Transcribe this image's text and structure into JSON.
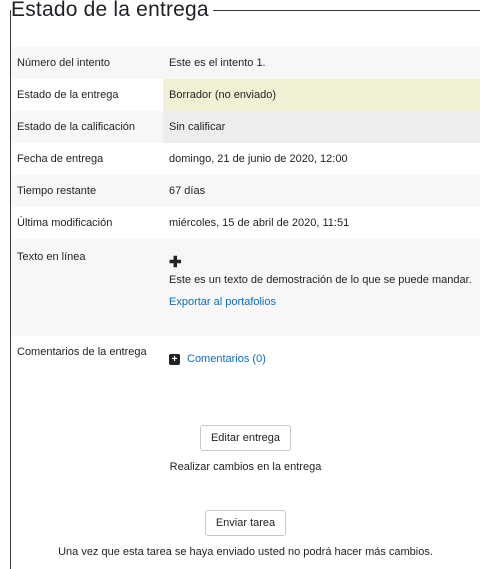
{
  "heading": "Estado de la entrega",
  "rows": [
    {
      "label": "Número del intento",
      "value": "Este es el intento 1."
    },
    {
      "label": "Estado de la entrega",
      "value": "Borrador (no enviado)"
    },
    {
      "label": "Estado de la calificación",
      "value": "Sin calificar"
    },
    {
      "label": "Fecha de entrega",
      "value": "domingo, 21 de junio de 2020, 12:00"
    },
    {
      "label": "Tiempo restante",
      "value": "67 días"
    },
    {
      "label": "Última modificación",
      "value": "miércoles, 15 de abril de 2020, 11:51"
    }
  ],
  "online_text": {
    "label": "Texto en línea",
    "expand_icon": "plus-icon",
    "text": "Este es un texto de demostración de lo que se puede mandar.",
    "export_link": "Exportar al portafolios"
  },
  "comments": {
    "label": "Comentarios de la entrega",
    "expand_icon": "plus-square-icon",
    "link": "Comentarios (0)"
  },
  "actions": {
    "edit_button": "Editar entrega",
    "edit_help": "Realizar cambios en la entrega",
    "submit_button": "Enviar tarea",
    "submit_help": "Una vez que esta tarea se haya enviado usted no podrá hacer más cambios."
  },
  "colors": {
    "draft_bg": "#f1f0d5",
    "link": "#0f6cbf"
  }
}
